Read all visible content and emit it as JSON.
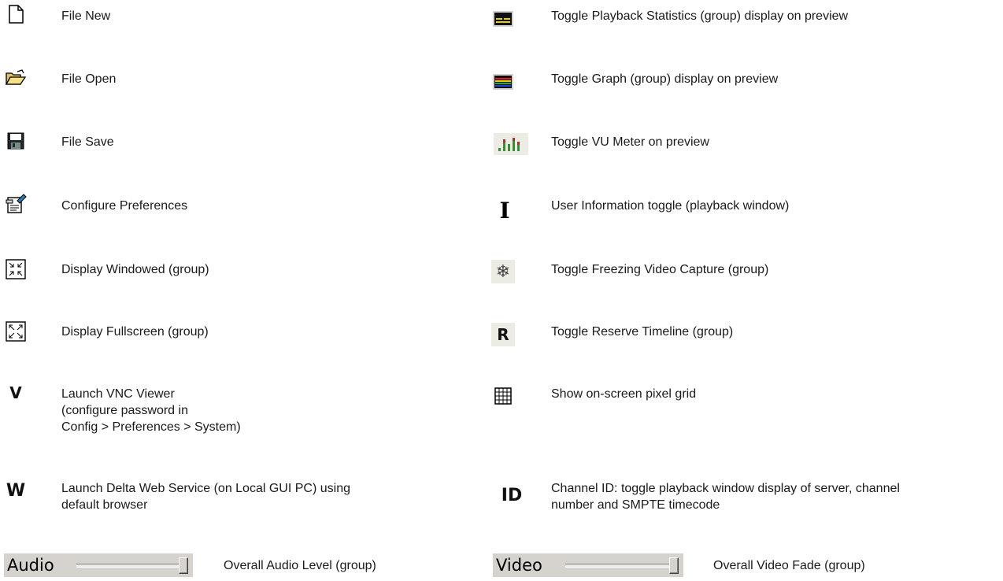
{
  "left_items": [
    {
      "icon": "file-new-icon",
      "text": [
        "File New"
      ]
    },
    {
      "icon": "file-open-icon",
      "text": [
        "File Open"
      ]
    },
    {
      "icon": "file-save-icon",
      "text": [
        "File Save"
      ]
    },
    {
      "icon": "configure-preferences-icon",
      "text": [
        "Configure Preferences"
      ]
    },
    {
      "icon": "display-windowed-icon",
      "text": [
        "Display Windowed (group)"
      ]
    },
    {
      "icon": "display-fullscreen-icon",
      "text": [
        "Display Fullscreen (group)"
      ]
    },
    {
      "icon": "vnc-viewer-icon",
      "glyph": "V",
      "text": [
        "Launch VNC Viewer",
        "(configure password in",
        "Config > Preferences > System)"
      ]
    },
    {
      "icon": "web-service-icon",
      "glyph": "W",
      "text": [
        "Launch Delta Web Service (on Local GUI PC) using",
        "default browser"
      ]
    }
  ],
  "right_items": [
    {
      "icon": "playback-statistics-icon",
      "text": [
        "Toggle Playback Statistics (group) display on preview"
      ]
    },
    {
      "icon": "graph-icon",
      "text": [
        "Toggle Graph (group) display on preview"
      ]
    },
    {
      "icon": "vu-meter-icon",
      "text": [
        "Toggle VU Meter on preview"
      ]
    },
    {
      "icon": "user-information-icon",
      "glyph": "I",
      "text": [
        "User Information toggle (playback window)"
      ]
    },
    {
      "icon": "freeze-capture-icon",
      "glyph": "❄",
      "text": [
        "Toggle Freezing Video Capture (group)"
      ]
    },
    {
      "icon": "reserve-timeline-icon",
      "glyph": "R",
      "text": [
        "Toggle Reserve Timeline (group)"
      ]
    },
    {
      "icon": "pixel-grid-icon",
      "text": [
        "Show on-screen pixel grid"
      ]
    },
    {
      "icon": "channel-id-icon",
      "glyph": "ID",
      "text": [
        "Channel ID: toggle playback window display of server, channel",
        "number and SMPTE timecode"
      ]
    }
  ],
  "sliders": [
    {
      "label": "Audio",
      "text": "Overall Audio Level (group)"
    },
    {
      "label": "Video",
      "text": "Overall Video Fade (group)"
    }
  ]
}
